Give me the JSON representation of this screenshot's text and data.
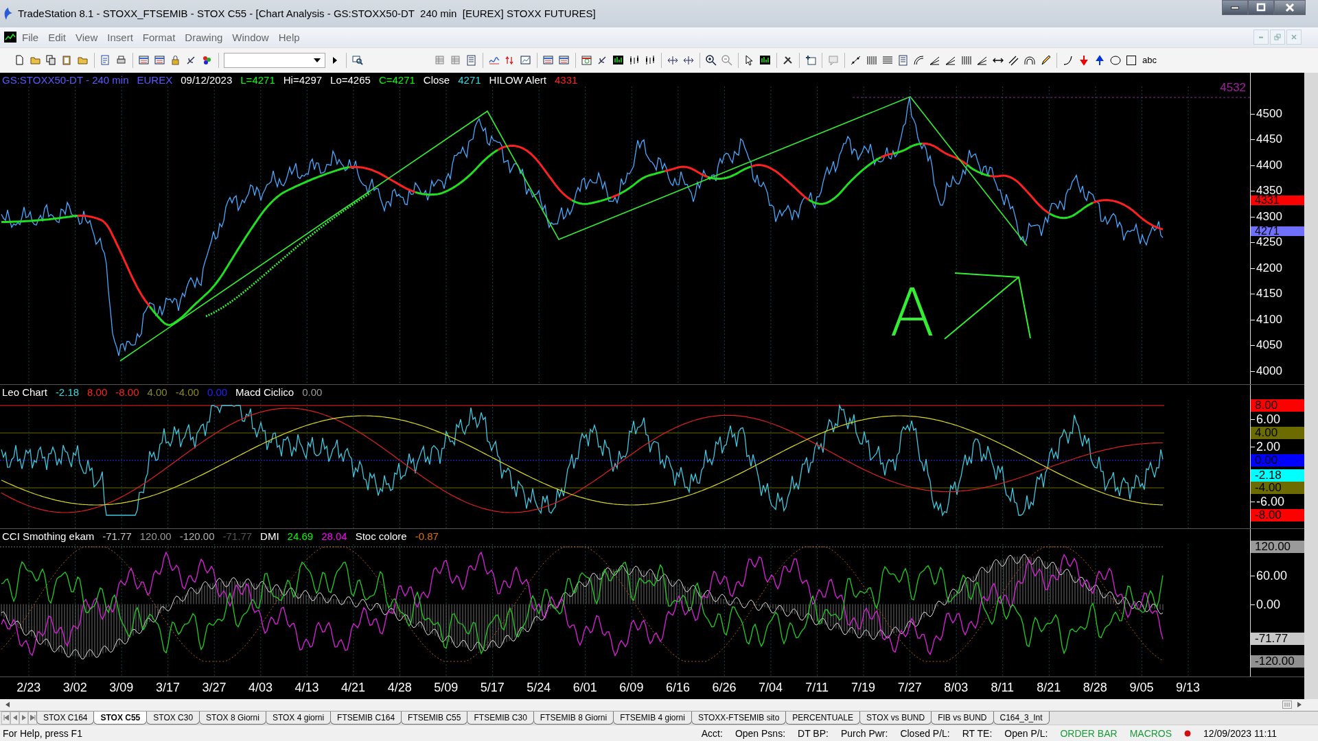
{
  "window": {
    "title": "TradeStation 8.1 - STOXX_FTSEMIB - STOX C55 - [Chart Analysis - GS:STOXX50-DT  240 min  [EUREX] STOXX FUTURES]"
  },
  "menu": [
    "File",
    "Edit",
    "View",
    "Insert",
    "Format",
    "Drawing",
    "Window",
    "Help"
  ],
  "toolbar": {
    "text_tool_label": "abc"
  },
  "price_pane": {
    "legend": [
      {
        "text": "GS:STOXX50-DT - 240 min",
        "color": "#5a5aff"
      },
      {
        "text": "EUREX",
        "color": "#5a5aff"
      },
      {
        "text": "09/12/2023",
        "color": "#ffffff"
      },
      {
        "text": "L=4271",
        "color": "#00ff00"
      },
      {
        "text": "Hi=4297",
        "color": "#ffffff"
      },
      {
        "text": "Lo=4265",
        "color": "#ffffff"
      },
      {
        "text": "C=4271",
        "color": "#00ff00"
      },
      {
        "text": "Close",
        "color": "#ffffff"
      },
      {
        "text": "4271",
        "color": "#33dddd"
      },
      {
        "text": "HILOW Alert",
        "color": "#ffffff"
      },
      {
        "text": "4331",
        "color": "#ff2020"
      }
    ],
    "annotation": "A",
    "high_marker": "4532",
    "ticks": [
      "4500",
      "4450",
      "4400",
      "4350",
      "4300",
      "4250",
      "4200",
      "4150",
      "4100",
      "4050",
      "4000"
    ],
    "markers": [
      {
        "text": "4331",
        "color": "#ff0000"
      },
      {
        "text": "4271",
        "color": "#7070ff"
      }
    ]
  },
  "leo_pane": {
    "legend": [
      {
        "text": "Leo Chart",
        "color": "#ffffff"
      },
      {
        "text": "-2.18",
        "color": "#33dddd"
      },
      {
        "text": "8.00",
        "color": "#ff2020"
      },
      {
        "text": "-8.00",
        "color": "#ff2020"
      },
      {
        "text": "4.00",
        "color": "#8a8a20"
      },
      {
        "text": "-4.00",
        "color": "#8a8a20"
      },
      {
        "text": "0.00",
        "color": "#2020ff"
      },
      {
        "text": "Macd Ciclico",
        "color": "#ffffff"
      },
      {
        "text": "0.00",
        "color": "#9a9a9a"
      }
    ],
    "ticks": [
      "6.00",
      "2.00",
      "-6.00"
    ],
    "markers": [
      {
        "text": "8.00",
        "color": "#ff0000"
      },
      {
        "text": "4.00",
        "color": "#6b6b00"
      },
      {
        "text": "0.00",
        "color": "#0000ff"
      },
      {
        "text": "-2.18",
        "color": "#00ffff"
      },
      {
        "text": "-4.00",
        "color": "#6b6b00"
      },
      {
        "text": "-8.00",
        "color": "#ff0000"
      }
    ]
  },
  "cci_pane": {
    "legend": [
      {
        "text": "CCI Smothing ekam",
        "color": "#ffffff"
      },
      {
        "text": "-71.77",
        "color": "#c8c8c8"
      },
      {
        "text": "120.00",
        "color": "#9a9a9a"
      },
      {
        "text": "-120.00",
        "color": "#b0b0b0"
      },
      {
        "text": "-71.77",
        "color": "#555555"
      },
      {
        "text": "DMI",
        "color": "#ffffff"
      },
      {
        "text": "24.69",
        "color": "#00ff00"
      },
      {
        "text": "28.04",
        "color": "#ff00ff"
      },
      {
        "text": "Stoc colore",
        "color": "#ffffff"
      },
      {
        "text": "-0.87",
        "color": "#e07000"
      }
    ],
    "ticks": [
      "60.00",
      "0.00"
    ],
    "markers": [
      {
        "text": "120.00",
        "color": "#9a9a9a"
      },
      {
        "text": "-71.77",
        "color": "#c8c8c8"
      },
      {
        "text": "-120.00",
        "color": "#909090"
      }
    ]
  },
  "date_axis": [
    "2/23",
    "3/02",
    "3/09",
    "3/17",
    "3/27",
    "4/03",
    "4/13",
    "4/21",
    "4/28",
    "5/09",
    "5/17",
    "5/24",
    "6/01",
    "6/09",
    "6/16",
    "6/26",
    "7/04",
    "7/11",
    "7/19",
    "7/27",
    "8/03",
    "8/11",
    "8/21",
    "8/28",
    "9/05",
    "9/13"
  ],
  "sheet_tabs": [
    {
      "label": "STOX C164",
      "selected": false
    },
    {
      "label": "STOX C55",
      "selected": true
    },
    {
      "label": "STOX C30",
      "selected": false
    },
    {
      "label": "STOX 8 Giorni",
      "selected": false
    },
    {
      "label": "STOX 4 giorni",
      "selected": false
    },
    {
      "label": "FTSEMIB C164",
      "selected": false
    },
    {
      "label": "FTSEMIB C55",
      "selected": false
    },
    {
      "label": "FTSEMIB C30",
      "selected": false
    },
    {
      "label": "FTSEMIB 8 Giorni",
      "selected": false
    },
    {
      "label": "FTSEMIB 4 giorni",
      "selected": false
    },
    {
      "label": "STOXX-FTSEMIB sito",
      "selected": false
    },
    {
      "label": "PERCENTUALE",
      "selected": false
    },
    {
      "label": "STOX vs BUND",
      "selected": false
    },
    {
      "label": "FIB vs BUND",
      "selected": false
    },
    {
      "label": "C164_3_Int",
      "selected": false
    }
  ],
  "status_bar": {
    "help": "For Help, press F1",
    "fields": [
      {
        "text": "Acct:",
        "color": "#000000"
      },
      {
        "text": "Open Psns:",
        "color": "#000000"
      },
      {
        "text": "DT BP:",
        "color": "#000000"
      },
      {
        "text": "Purch Pwr:",
        "color": "#000000"
      },
      {
        "text": "Closed P/L:",
        "color": "#000000"
      },
      {
        "text": "RT TE:",
        "color": "#000000"
      },
      {
        "text": "Open P/L:",
        "color": "#000000"
      },
      {
        "text": "ORDER BAR",
        "color": "#1a9a3a"
      },
      {
        "text": "MACROS",
        "color": "#1a9a3a"
      }
    ],
    "time": "12/09/2023 11:11"
  }
}
